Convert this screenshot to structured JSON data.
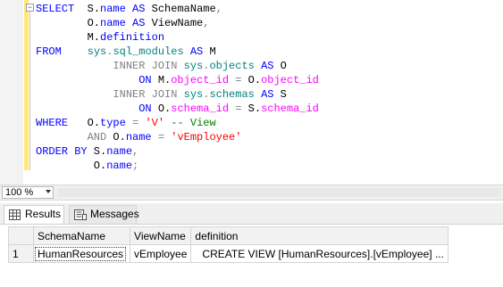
{
  "editor": {
    "lines": [
      [
        {
          "t": "SELECT",
          "c": "kw"
        },
        {
          "t": "  S.",
          "c": ""
        },
        {
          "t": "name",
          "c": "kw"
        },
        {
          "t": " ",
          "c": ""
        },
        {
          "t": "AS",
          "c": "kw"
        },
        {
          "t": " SchemaName",
          "c": ""
        },
        {
          "t": ",",
          "c": "gray"
        }
      ],
      [
        {
          "t": "        O.",
          "c": ""
        },
        {
          "t": "name",
          "c": "kw"
        },
        {
          "t": " ",
          "c": ""
        },
        {
          "t": "AS",
          "c": "kw"
        },
        {
          "t": " ViewName",
          "c": ""
        },
        {
          "t": ",",
          "c": "gray"
        }
      ],
      [
        {
          "t": "        M.",
          "c": ""
        },
        {
          "t": "definition",
          "c": "kw"
        }
      ],
      [
        {
          "t": "FROM",
          "c": "kw"
        },
        {
          "t": "    ",
          "c": ""
        },
        {
          "t": "sys",
          "c": "teal"
        },
        {
          "t": ".",
          "c": "gray"
        },
        {
          "t": "sql_modules",
          "c": "teal"
        },
        {
          "t": " ",
          "c": ""
        },
        {
          "t": "AS",
          "c": "kw"
        },
        {
          "t": " M",
          "c": ""
        }
      ],
      [
        {
          "t": "            ",
          "c": ""
        },
        {
          "t": "INNER JOIN",
          "c": "gray"
        },
        {
          "t": " ",
          "c": ""
        },
        {
          "t": "sys",
          "c": "teal"
        },
        {
          "t": ".",
          "c": "gray"
        },
        {
          "t": "objects",
          "c": "teal"
        },
        {
          "t": " ",
          "c": ""
        },
        {
          "t": "AS",
          "c": "kw"
        },
        {
          "t": " O",
          "c": ""
        }
      ],
      [
        {
          "t": "                ",
          "c": ""
        },
        {
          "t": "ON",
          "c": "kw"
        },
        {
          "t": " M.",
          "c": ""
        },
        {
          "t": "object_id",
          "c": "fn"
        },
        {
          "t": " ",
          "c": ""
        },
        {
          "t": "=",
          "c": "gray"
        },
        {
          "t": " O.",
          "c": ""
        },
        {
          "t": "object_id",
          "c": "fn"
        }
      ],
      [
        {
          "t": "            ",
          "c": ""
        },
        {
          "t": "INNER JOIN",
          "c": "gray"
        },
        {
          "t": " ",
          "c": ""
        },
        {
          "t": "sys",
          "c": "teal"
        },
        {
          "t": ".",
          "c": "gray"
        },
        {
          "t": "schemas",
          "c": "teal"
        },
        {
          "t": " ",
          "c": ""
        },
        {
          "t": "AS",
          "c": "kw"
        },
        {
          "t": " S",
          "c": ""
        }
      ],
      [
        {
          "t": "                ",
          "c": ""
        },
        {
          "t": "ON",
          "c": "kw"
        },
        {
          "t": " O.",
          "c": ""
        },
        {
          "t": "schema_id",
          "c": "fn"
        },
        {
          "t": " ",
          "c": ""
        },
        {
          "t": "=",
          "c": "gray"
        },
        {
          "t": " S.",
          "c": ""
        },
        {
          "t": "schema_id",
          "c": "fn"
        }
      ],
      [
        {
          "t": "WHERE",
          "c": "kw"
        },
        {
          "t": "   O.",
          "c": ""
        },
        {
          "t": "type",
          "c": "kw"
        },
        {
          "t": " ",
          "c": ""
        },
        {
          "t": "=",
          "c": "gray"
        },
        {
          "t": " ",
          "c": ""
        },
        {
          "t": "'V'",
          "c": "str"
        },
        {
          "t": " ",
          "c": ""
        },
        {
          "t": "-- View",
          "c": "cmt"
        }
      ],
      [
        {
          "t": "        ",
          "c": ""
        },
        {
          "t": "AND",
          "c": "gray"
        },
        {
          "t": " O.",
          "c": ""
        },
        {
          "t": "name",
          "c": "kw"
        },
        {
          "t": " ",
          "c": ""
        },
        {
          "t": "=",
          "c": "gray"
        },
        {
          "t": " ",
          "c": ""
        },
        {
          "t": "'vEmployee'",
          "c": "str"
        }
      ],
      [
        {
          "t": "ORDER BY",
          "c": "kw"
        },
        {
          "t": " S.",
          "c": ""
        },
        {
          "t": "name",
          "c": "kw"
        },
        {
          "t": ",",
          "c": "gray"
        }
      ],
      [
        {
          "t": "         O.",
          "c": ""
        },
        {
          "t": "name",
          "c": "kw"
        },
        {
          "t": ";",
          "c": "gray"
        }
      ]
    ],
    "collapse_glyph": "−",
    "colors": {
      "keyword": "#0000ff",
      "operator": "#808080",
      "system_object": "#008080",
      "function": "#ff00ff",
      "string": "#ff0000",
      "comment": "#008000",
      "change_bar": "#ffe87a"
    }
  },
  "zoom": {
    "value": "100 %"
  },
  "tabs": [
    {
      "label": "Results",
      "icon": "grid-icon",
      "active": true
    },
    {
      "label": "Messages",
      "icon": "messages-icon",
      "active": false
    }
  ],
  "grid": {
    "columns": [
      "SchemaName",
      "ViewName",
      "definition"
    ],
    "rows": [
      {
        "num": "1",
        "cells": [
          "HumanResources",
          "vEmployee",
          "CREATE VIEW [HumanResources].[vEmployee]  ..."
        ]
      }
    ]
  }
}
